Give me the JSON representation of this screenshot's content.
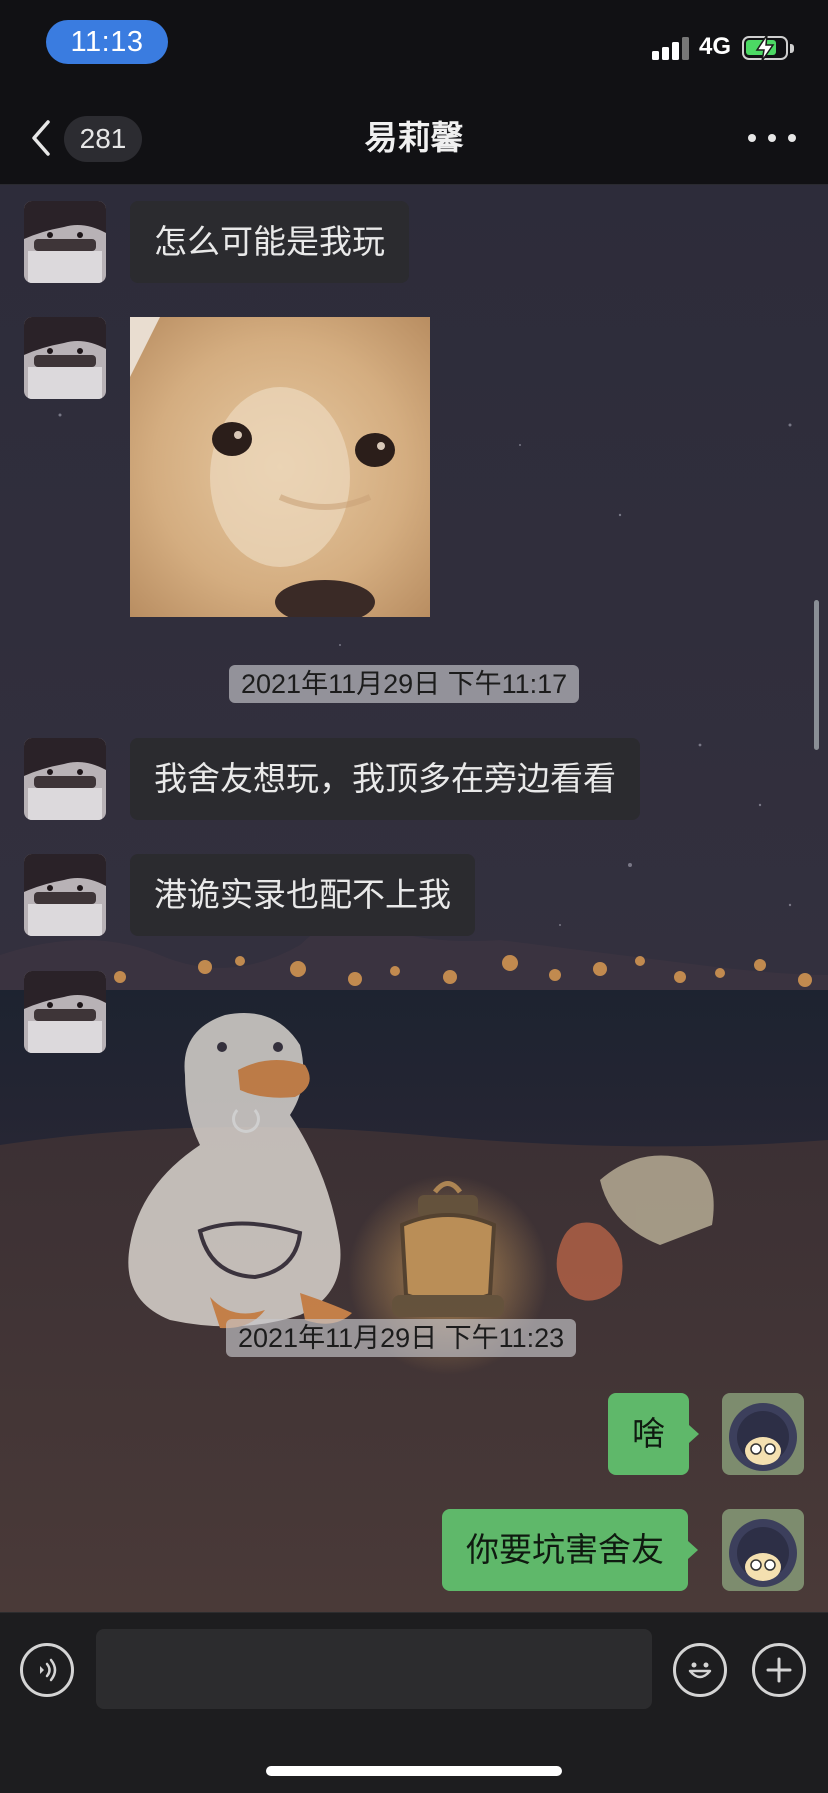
{
  "status_bar": {
    "time": "11:13",
    "network": "4G",
    "battery_level": 0.8,
    "colors": {
      "time_pill": "#3a7ce0",
      "battery_fill": "#4cd964"
    }
  },
  "nav": {
    "back_icon": "chevron-left-icon",
    "unread_count": "281",
    "title": "易莉馨",
    "more_icon": "more-dots-icon"
  },
  "messages": [
    {
      "type": "text",
      "side": "left",
      "text": "怎么可能是我玩"
    },
    {
      "type": "image",
      "side": "left",
      "content": "shiba-dog-closeup"
    },
    {
      "type": "timestamp",
      "text": "2021年11月29日 下午11:17"
    },
    {
      "type": "text",
      "side": "left",
      "text": "我舍友想玩，我顶多在旁边看看"
    },
    {
      "type": "text",
      "side": "left",
      "text": "港诡实录也配不上我"
    },
    {
      "type": "loading",
      "side": "left"
    },
    {
      "type": "timestamp",
      "text": "2021年11月29日 下午11:23"
    },
    {
      "type": "text",
      "side": "right",
      "text": "啥"
    },
    {
      "type": "text",
      "side": "right",
      "text": "你要坑害舍友"
    }
  ],
  "input_bar": {
    "voice_icon": "voice-icon",
    "text_value": "",
    "emoji_icon": "emoji-icon",
    "plus_icon": "plus-icon"
  },
  "colors": {
    "outgoing_bubble": "#5fb86a",
    "incoming_bubble": "#2b2b2f",
    "background": "#1b1b22"
  }
}
